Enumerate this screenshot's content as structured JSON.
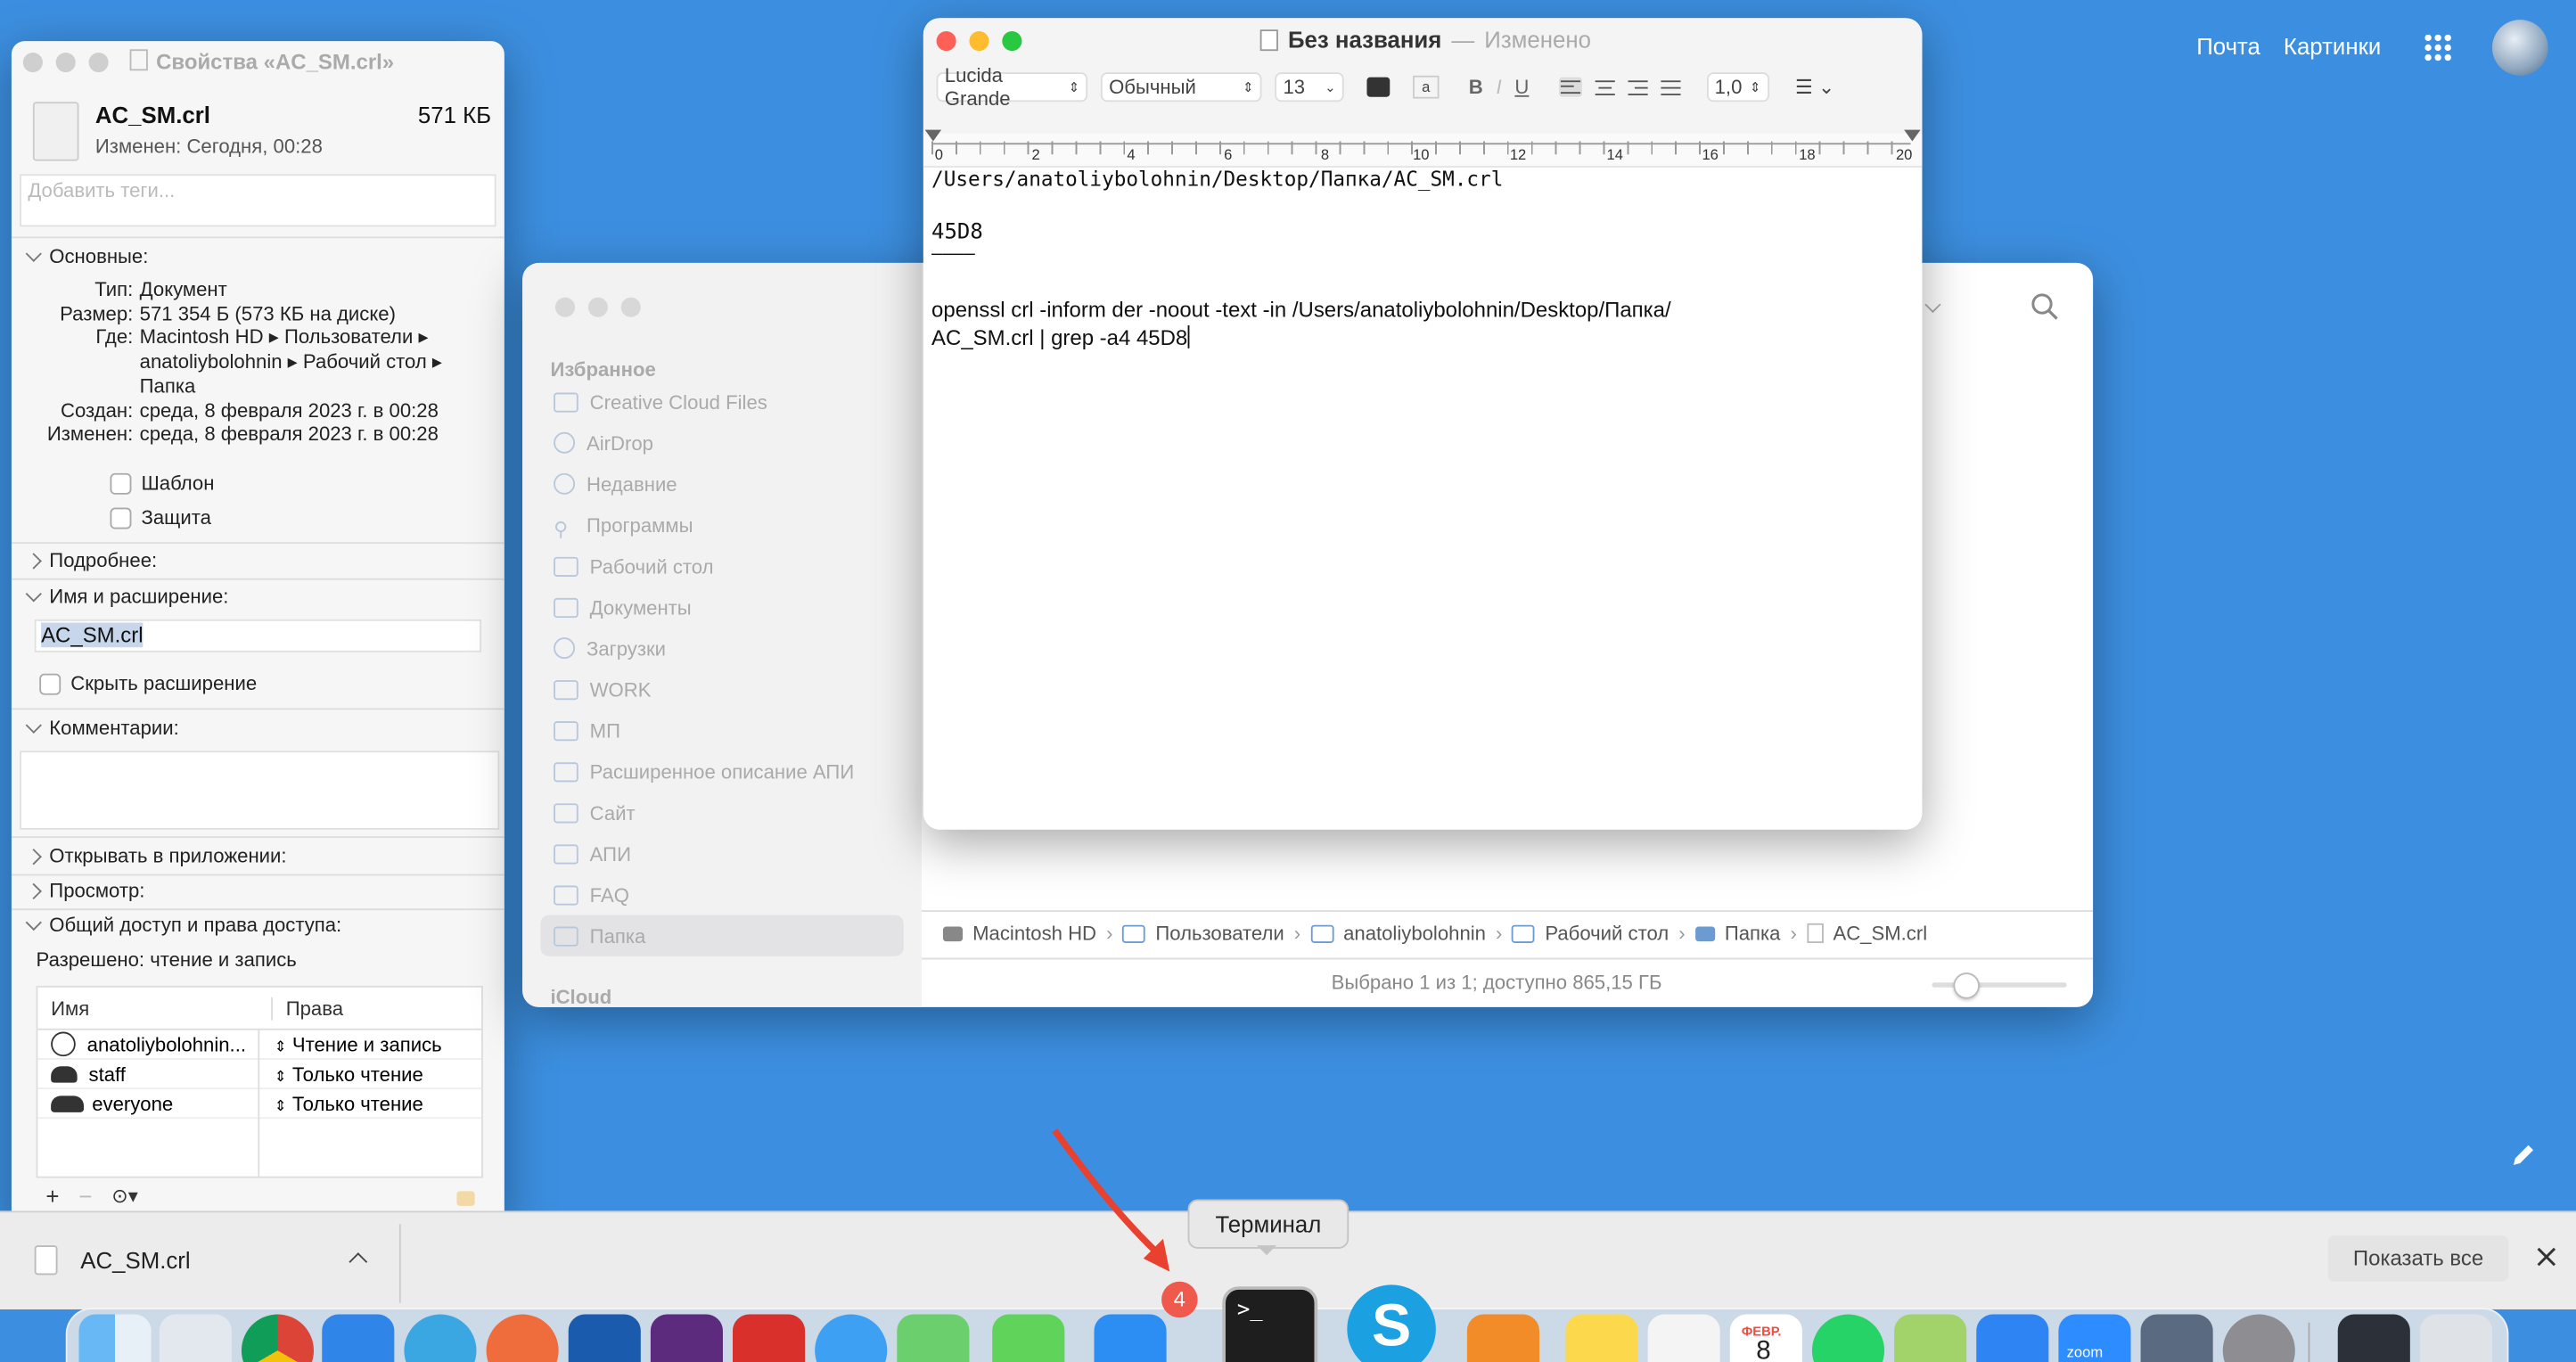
{
  "browser": {
    "top_links": [
      "Почта",
      "Картинки"
    ]
  },
  "info_window": {
    "title": "Свойства «AC_SM.crl»",
    "file_name": "AC_SM.crl",
    "file_size": "571 КБ",
    "modified_short": "Изменен: Сегодня, 00:28",
    "tags_placeholder": "Добавить теги...",
    "general": {
      "label": "Основные:",
      "rows": [
        {
          "k": "Тип:",
          "v": "Документ"
        },
        {
          "k": "Размер:",
          "v": "571 354 Б (573 КБ на диске)"
        },
        {
          "k": "Где:",
          "v": "Macintosh HD ▸ Пользователи ▸"
        },
        {
          "k": "",
          "v": "anatoliybolohnin ▸ Рабочий стол ▸"
        },
        {
          "k": "",
          "v": "Папка"
        },
        {
          "k": "Создан:",
          "v": "среда, 8 февраля 2023 г. в 00:28"
        },
        {
          "k": "Изменен:",
          "v": "среда, 8 февраля 2023 г. в 00:28"
        }
      ],
      "checkbox_template": "Шаблон",
      "checkbox_locked": "Защита"
    },
    "more_info": "Подробнее:",
    "name_ext": {
      "label": "Имя и расширение:",
      "value": "AC_SM.crl",
      "hide_ext": "Скрыть расширение"
    },
    "comments": "Комментарии:",
    "open_with": "Открывать в приложении:",
    "preview": "Просмотр:",
    "sharing": {
      "label": "Общий доступ и права доступа:",
      "status": "Разрешено: чтение и запись",
      "col_name": "Имя",
      "col_rights": "Права",
      "rows": [
        {
          "name": "anatoliybolohnin...",
          "rights": "Чтение и запись"
        },
        {
          "name": "staff",
          "rights": "Только чтение"
        },
        {
          "name": "everyone",
          "rights": "Только чтение"
        }
      ]
    }
  },
  "finder": {
    "section": "Избранное",
    "items": [
      "Creative Cloud Files",
      "AirDrop",
      "Недавние",
      "Программы",
      "Рабочий стол",
      "Документы",
      "Загрузки",
      "WORK",
      "МП",
      "Расширенное описание АПИ",
      "Сайт",
      "АПИ",
      "FAQ",
      "Папка"
    ],
    "icloud": "iCloud",
    "path": [
      "Macintosh HD",
      "Пользователи",
      "anatoliybolohnin",
      "Рабочий стол",
      "Папка",
      "AC_SM.crl"
    ],
    "status": "Выбрано 1 из 1; доступно 865,15 ГБ"
  },
  "textedit": {
    "title": "Без названия",
    "edited": "Изменено",
    "font": "Lucida Grande",
    "style": "Обычный",
    "size": "13",
    "spacing": "1,0",
    "ruler": [
      "0",
      "2",
      "4",
      "6",
      "8",
      "10",
      "12",
      "14",
      "16",
      "18",
      "20"
    ],
    "line1": "/Users/anatoliybolohnin/Desktop/Папка/AC_SM.crl",
    "line2": "45D8",
    "line3": "————",
    "line4": "openssl crl -inform der -noout -text -in /Users/anatoliybolohnin/Desktop/Папка/",
    "line5": "AC_SM.crl | grep -a4 45D8"
  },
  "download_bar": {
    "file": "AC_SM.crl",
    "show_all": "Показать все"
  },
  "dock": {
    "tooltip": "Терминал",
    "badge": "4",
    "calendar_month": "ФЕВР.",
    "calendar_day": "8",
    "zoom_label": "zoom"
  }
}
